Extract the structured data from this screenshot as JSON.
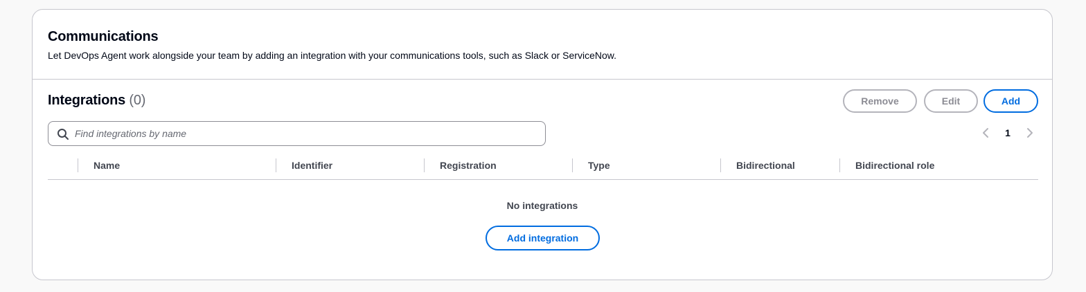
{
  "header": {
    "title": "Communications",
    "description": "Let DevOps Agent work alongside your team by adding an integration with your communications tools, such as Slack or ServiceNow."
  },
  "table": {
    "title": "Integrations",
    "count": "(0)",
    "actions": {
      "remove": "Remove",
      "edit": "Edit",
      "add": "Add"
    },
    "search": {
      "placeholder": "Find integrations by name",
      "value": ""
    },
    "pagination": {
      "current_page": "1"
    },
    "columns": [
      "Name",
      "Identifier",
      "Registration",
      "Type",
      "Bidirectional",
      "Bidirectional role"
    ],
    "empty_state": {
      "message": "No integrations",
      "action": "Add integration"
    }
  },
  "colors": {
    "accent": "#006ce0",
    "disabled": "#8c8c94",
    "border": "#c6c6cd",
    "text": "#000716",
    "muted": "#424650"
  },
  "icons": {
    "search": "search-icon",
    "prev": "chevron-left-icon",
    "next": "chevron-right-icon"
  }
}
